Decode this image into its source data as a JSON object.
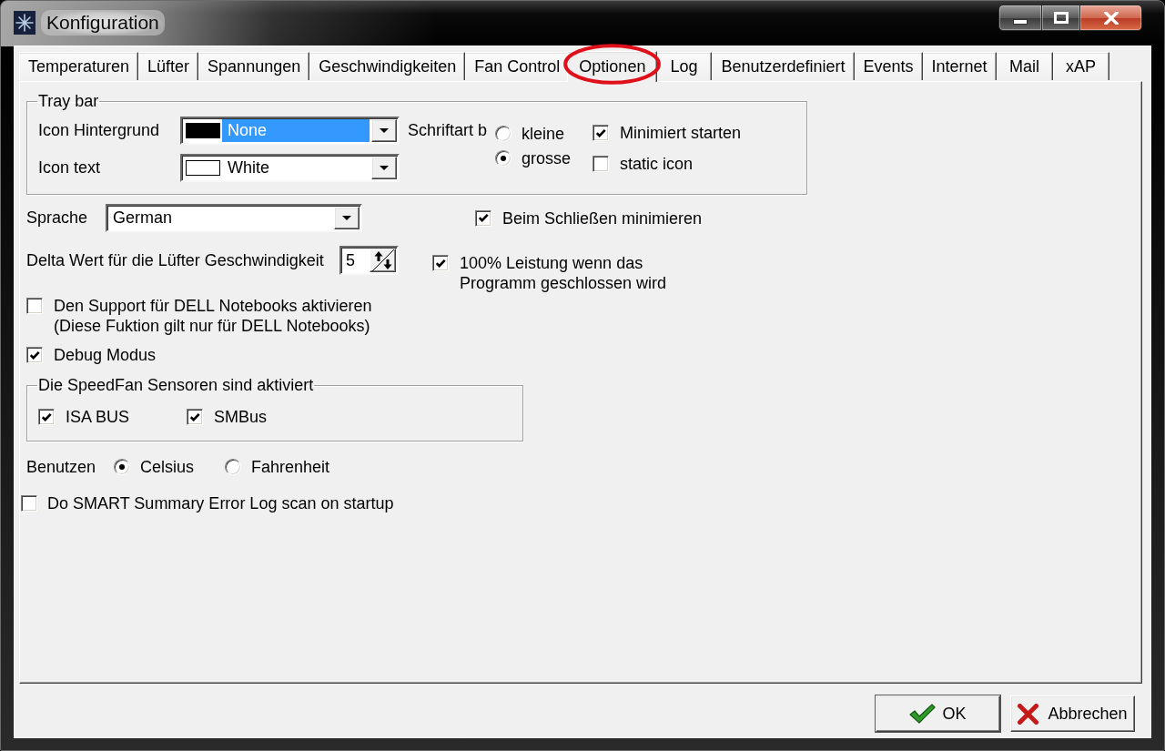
{
  "window": {
    "title": "Konfiguration"
  },
  "tabs": [
    {
      "label": "Temperaturen",
      "selected": false,
      "circled": false
    },
    {
      "label": "Lüfter",
      "selected": false,
      "circled": false
    },
    {
      "label": "Spannungen",
      "selected": false,
      "circled": false
    },
    {
      "label": "Geschwindigkeiten",
      "selected": false,
      "circled": false
    },
    {
      "label": "Fan Control",
      "selected": false,
      "circled": false
    },
    {
      "label": "Optionen",
      "selected": true,
      "circled": true
    },
    {
      "label": "Log",
      "selected": false,
      "circled": false
    },
    {
      "label": "Benutzerdefiniert",
      "selected": false,
      "circled": false
    },
    {
      "label": "Events",
      "selected": false,
      "circled": false
    },
    {
      "label": "Internet",
      "selected": false,
      "circled": false
    },
    {
      "label": "Mail",
      "selected": false,
      "circled": false
    },
    {
      "label": "xAP",
      "selected": false,
      "circled": false
    }
  ],
  "tray_bar": {
    "legend": "Tray bar",
    "dropdowns": [
      {
        "label": "Icon Hintergrund",
        "value": "None",
        "color": "#000000",
        "focused": true
      },
      {
        "label": "Icon text",
        "value": "White",
        "color": "#ffffff",
        "focused": false
      }
    ],
    "font_size": {
      "label": "Schriftart b",
      "options": [
        {
          "label": "kleine",
          "selected": false
        },
        {
          "label": "grosse",
          "selected": true
        }
      ]
    },
    "checkboxes": [
      {
        "label": "Minimiert starten",
        "checked": true
      },
      {
        "label": "static icon",
        "checked": false
      }
    ]
  },
  "language": {
    "label": "Sprache",
    "value": "German"
  },
  "minimize_on_close": {
    "label": "Beim Schließen minimieren",
    "checked": true
  },
  "fan_speed_delta": {
    "label": "Delta Wert für die Lüfter Geschwindigkeit",
    "value": "5"
  },
  "full_power_on_exit": {
    "label": "100% Leistung wenn das\nProgramm geschlossen wird",
    "checked": true
  },
  "dell_support": {
    "label": "Den Support für DELL Notebooks aktivieren\n(Diese Fuktion gilt nur für DELL Notebooks)",
    "checked": false
  },
  "debug_mode": {
    "label": "Debug Modus",
    "checked": true
  },
  "speedfan_sensors": {
    "legend": "Die SpeedFan Sensoren sind aktiviert",
    "checkboxes": [
      {
        "label": "ISA BUS",
        "checked": true
      },
      {
        "label": "SMBus",
        "checked": true
      }
    ]
  },
  "temperature_unit": {
    "label": "Benutzen",
    "options": [
      {
        "label": "Celsius",
        "selected": true
      },
      {
        "label": "Fahrenheit",
        "selected": false
      }
    ]
  },
  "smart_scan": {
    "label": "Do SMART Summary Error Log scan on startup",
    "checked": false
  },
  "buttons": [
    {
      "label": "OK",
      "kind": "ok"
    },
    {
      "label": "Abbrechen",
      "kind": "cancel"
    }
  ]
}
